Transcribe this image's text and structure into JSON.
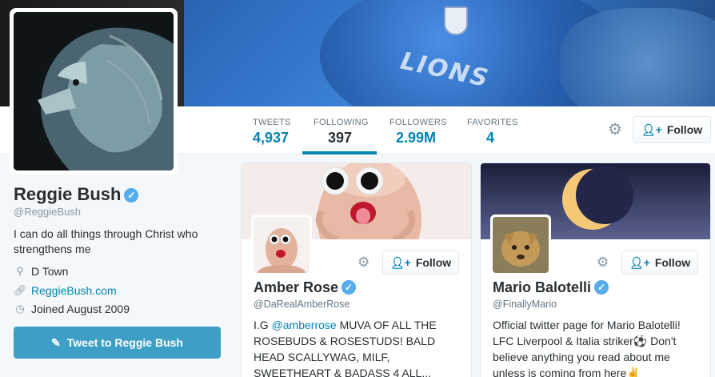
{
  "profile": {
    "name": "Reggie Bush",
    "handle": "@ReggieBush",
    "bio": "I can do all things through Christ who strengthens me",
    "location": "D Town",
    "website": "ReggieBush.com",
    "joined": "Joined August 2009",
    "tweet_button": "Tweet to Reggie Bush"
  },
  "banner": {
    "jersey_text": "LIONS"
  },
  "stats": [
    {
      "label": "TWEETS",
      "value": "4,937"
    },
    {
      "label": "FOLLOWING",
      "value": "397"
    },
    {
      "label": "FOLLOWERS",
      "value": "2.99M"
    },
    {
      "label": "FAVORITES",
      "value": "4"
    }
  ],
  "follow_label": "Follow",
  "cards": [
    {
      "name": "Amber Rose",
      "handle": "@DaRealAmberRose",
      "bio_prefix": "I.G ",
      "bio_mention": "@amberrose",
      "bio_rest": " MUVA OF ALL THE ROSEBUDS & ROSESTUDS! BALD HEAD SCALLYWAG, MILF, SWEETHEART & BADASS 4 ALL..."
    },
    {
      "name": "Mario Balotelli",
      "handle": "@FinallyMario",
      "bio": "Official twitter page for Mario Balotelli! LFC Liverpool & Italia striker⚽ Don't believe anything you read about me unless is coming from here✌"
    }
  ],
  "colors": {
    "accent": "#0084b4",
    "verified": "#55acee",
    "tweet_button": "#3d9fc6"
  },
  "icons": [
    "gear-icon",
    "add-user-icon",
    "location-icon",
    "link-icon",
    "calendar-icon",
    "quill-icon",
    "verified-icon"
  ]
}
